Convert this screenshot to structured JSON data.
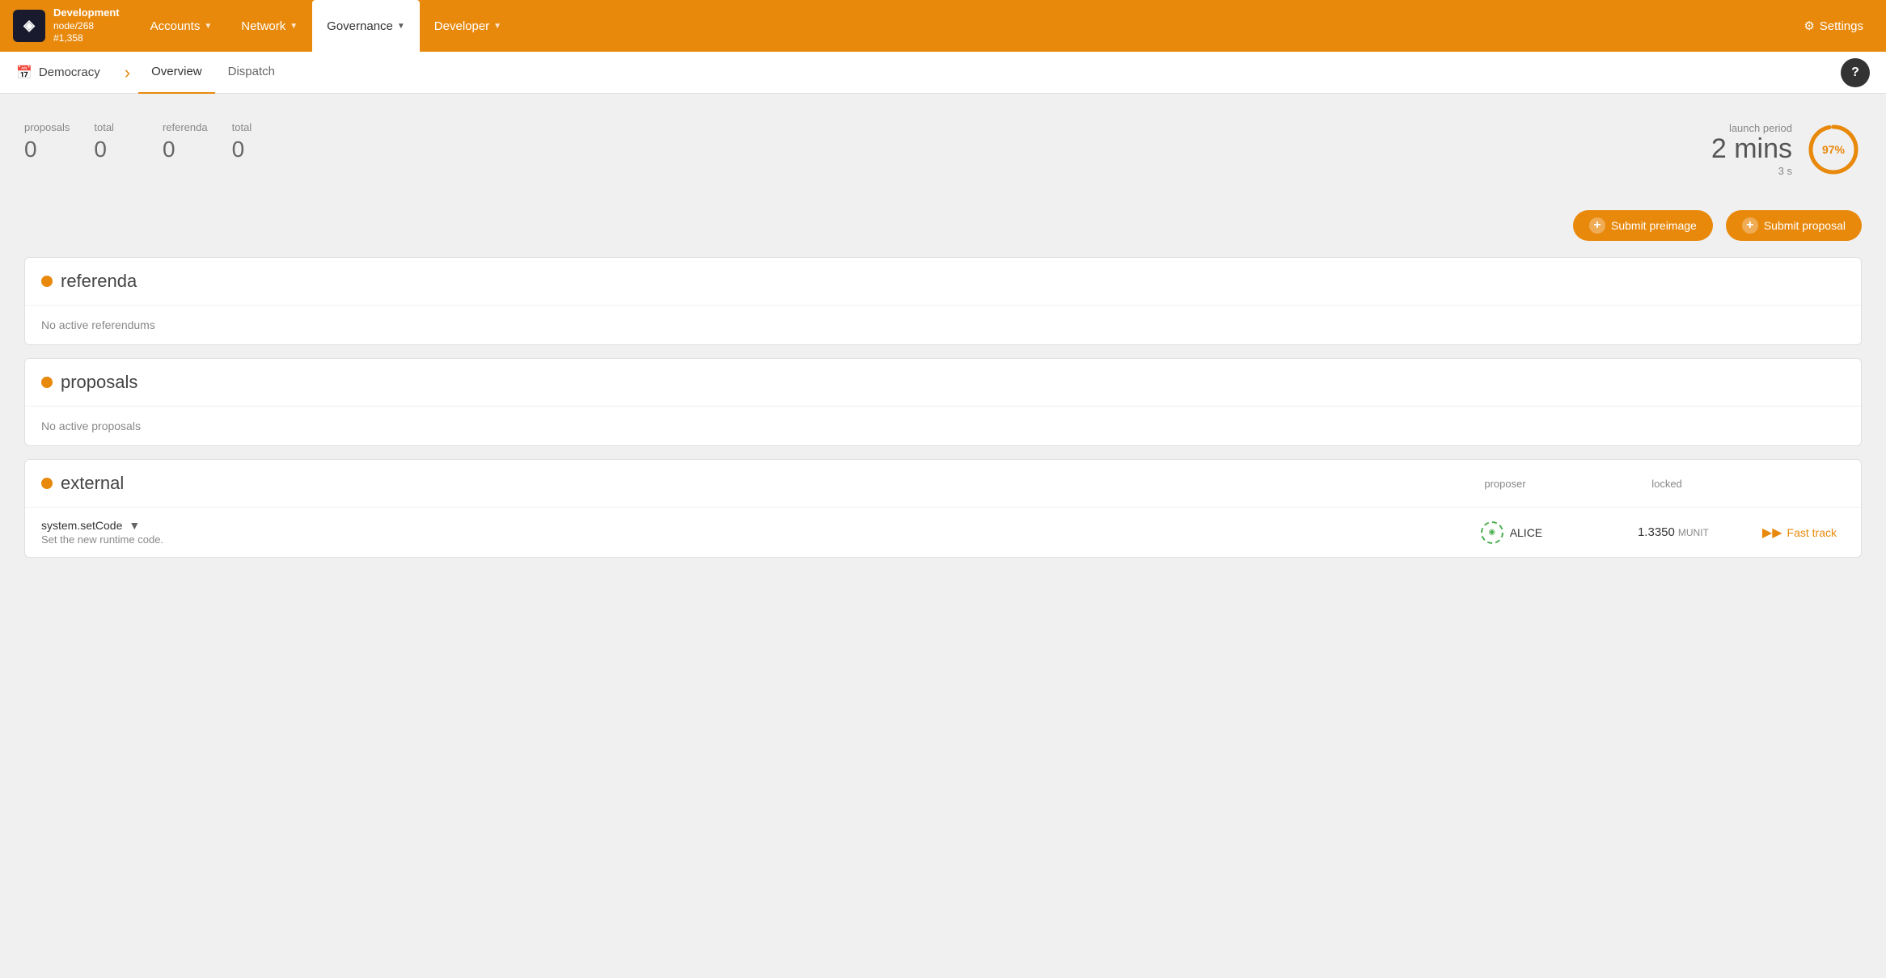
{
  "nav": {
    "logo": {
      "icon": "◈",
      "line1": "Development",
      "line2": "node/268",
      "line3": "#1,358"
    },
    "items": [
      {
        "label": "Accounts",
        "hasDropdown": true,
        "active": false
      },
      {
        "label": "Network",
        "hasDropdown": true,
        "active": false
      },
      {
        "label": "Governance",
        "hasDropdown": true,
        "active": true
      },
      {
        "label": "Developer",
        "hasDropdown": true,
        "active": false
      }
    ],
    "settings": {
      "icon": "⚙",
      "label": "Settings"
    }
  },
  "subnav": {
    "section": "Democracy",
    "tabs": [
      {
        "label": "Overview",
        "active": true
      },
      {
        "label": "Dispatch",
        "active": false
      }
    ],
    "help": "?"
  },
  "stats": {
    "proposals_label": "proposals",
    "proposals_value": "0",
    "total_label": "total",
    "total_value": "0",
    "referenda_label": "referenda",
    "referenda_value": "0",
    "referenda_total_label": "total",
    "referenda_total_value": "0",
    "launch_period_label": "launch period",
    "launch_mins": "2 mins",
    "launch_secs": "3 s",
    "progress_pct": 97,
    "progress_label": "97%"
  },
  "actions": {
    "submit_preimage": "Submit preimage",
    "submit_proposal": "Submit proposal"
  },
  "sections": {
    "referenda": {
      "title": "referenda",
      "empty_text": "No active referendums"
    },
    "proposals": {
      "title": "proposals",
      "empty_text": "No active proposals"
    },
    "external": {
      "title": "external",
      "proposer_col": "proposer",
      "locked_col": "locked",
      "rows": [
        {
          "method": "system.setCode",
          "description": "Set the new runtime code.",
          "proposer": "ALICE",
          "locked_value": "1.3350",
          "locked_unit": "MUNIT",
          "fast_track_label": "Fast track"
        }
      ]
    }
  }
}
